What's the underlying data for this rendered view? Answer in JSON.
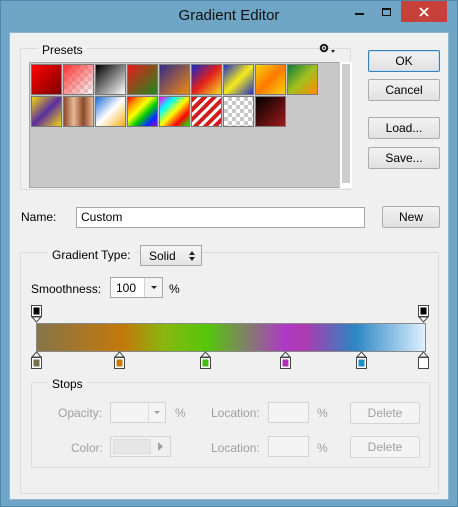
{
  "window": {
    "title": "Gradient Editor"
  },
  "presets": {
    "label": "Presets"
  },
  "buttons": {
    "ok": "OK",
    "cancel": "Cancel",
    "load": "Load...",
    "save": "Save...",
    "new": "New"
  },
  "name": {
    "label": "Name:",
    "value": "Custom"
  },
  "gradient_type": {
    "label": "Gradient Type:",
    "value": "Solid"
  },
  "smoothness": {
    "label": "Smoothness:",
    "value": "100",
    "unit": "%"
  },
  "stops": {
    "label": "Stops",
    "opacity_label": "Opacity:",
    "opacity_unit": "%",
    "color_label": "Color:",
    "location_label": "Location:",
    "location_unit": "%",
    "delete_label": "Delete"
  },
  "color_stops": [
    "#7a6e49",
    "#c77a0d",
    "#3fbe12",
    "#b12eb8",
    "#1b8ec5",
    "#ffffff"
  ],
  "colors": {
    "title_bar": "#6fa6c6",
    "close": "#c7403a",
    "dialog_bg": "#f0f0f0"
  }
}
